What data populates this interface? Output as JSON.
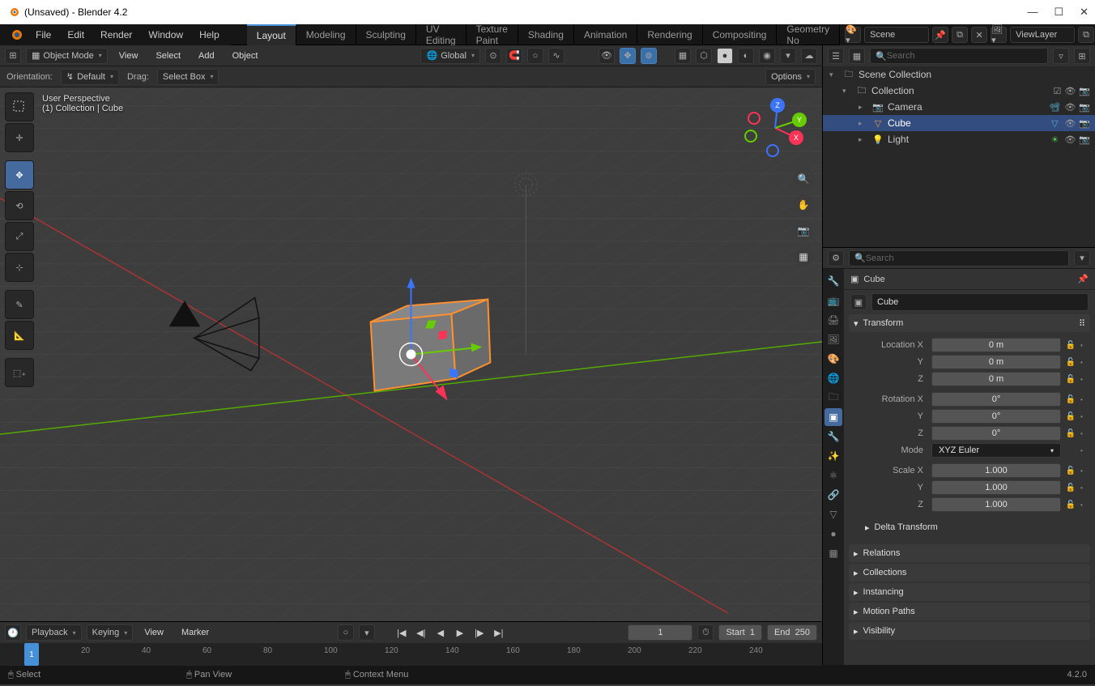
{
  "window": {
    "title": "(Unsaved) - Blender 4.2"
  },
  "menubar": {
    "items": [
      "File",
      "Edit",
      "Render",
      "Window",
      "Help"
    ]
  },
  "workspaces": {
    "active": "Layout",
    "tabs": [
      "Layout",
      "Modeling",
      "Sculpting",
      "UV Editing",
      "Texture Paint",
      "Shading",
      "Animation",
      "Rendering",
      "Compositing",
      "Geometry No"
    ]
  },
  "scene_row": {
    "scene": "Scene",
    "viewlayer": "ViewLayer"
  },
  "viewport_header": {
    "mode": "Object Mode",
    "menus": [
      "View",
      "Select",
      "Add",
      "Object"
    ],
    "orient": "Global",
    "options": "Options"
  },
  "viewport_subheader": {
    "orientation_label": "Orientation:",
    "orientation": "Default",
    "drag_label": "Drag:",
    "drag": "Select Box"
  },
  "viewport_info": {
    "line1": "User Perspective",
    "line2": "(1) Collection | Cube"
  },
  "gizmo_axes": {
    "x": "X",
    "y": "Y",
    "z": "Z"
  },
  "outliner": {
    "search_placeholder": "Search",
    "root": "Scene Collection",
    "collection": "Collection",
    "items": [
      {
        "name": "Camera",
        "icon": "📷"
      },
      {
        "name": "Cube",
        "icon": "▽",
        "selected": true
      },
      {
        "name": "Light",
        "icon": "💡"
      }
    ]
  },
  "properties": {
    "search_placeholder": "Search",
    "object_name": "Cube",
    "name_field": "Cube",
    "transform_label": "Transform",
    "location_label": "Location X",
    "location": [
      "0 m",
      "0 m",
      "0 m"
    ],
    "rotation_label": "Rotation X",
    "rotation": [
      "0°",
      "0°",
      "0°"
    ],
    "mode_label": "Mode",
    "mode": "XYZ Euler",
    "scale_label": "Scale X",
    "scale": [
      "1.000",
      "1.000",
      "1.000"
    ],
    "axis_labels": [
      "",
      "Y",
      "Z"
    ],
    "delta": "Delta Transform",
    "panels": [
      "Relations",
      "Collections",
      "Instancing",
      "Motion Paths",
      "Visibility"
    ]
  },
  "timeline": {
    "menus": [
      "Playback",
      "Keying",
      "View",
      "Marker"
    ],
    "current": "1",
    "start_label": "Start",
    "start": "1",
    "end_label": "End",
    "end": "250",
    "ticks": [
      "1",
      "20",
      "40",
      "60",
      "80",
      "100",
      "120",
      "140",
      "160",
      "180",
      "200",
      "220",
      "240"
    ]
  },
  "statusbar": {
    "select": "Select",
    "pan": "Pan View",
    "context": "Context Menu",
    "version": "4.2.0"
  }
}
